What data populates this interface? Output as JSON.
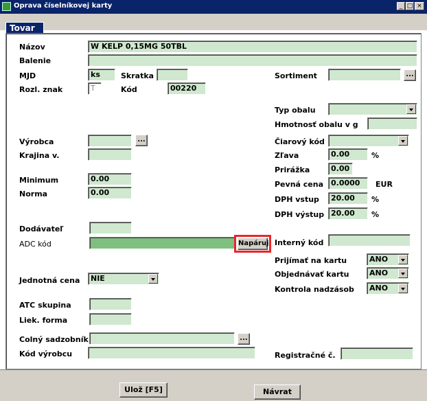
{
  "window": {
    "title": "Oprava číselníkovej karty",
    "controls": {
      "minimize": "_",
      "maximize": "□",
      "close": "×"
    }
  },
  "tabs": [
    {
      "label": "Tovar",
      "active": true
    }
  ],
  "form": {
    "nazov": {
      "label": "Názov",
      "value": "W KELP 0,15MG 50TBL"
    },
    "balenie": {
      "label": "Balenie",
      "value": ""
    },
    "mjd": {
      "label": "MJD",
      "value": "ks"
    },
    "skratka": {
      "label": "Skratka",
      "value": ""
    },
    "sortiment": {
      "label": "Sortiment",
      "value": "",
      "button": "..."
    },
    "rozl_znak": {
      "label": "Rozl. znak",
      "value": "T"
    },
    "kod": {
      "label": "Kód",
      "value": "00220"
    },
    "typ_obalu": {
      "label": "Typ obalu",
      "value": ""
    },
    "hmotnost_obalu": {
      "label": "Hmotnosť obalu v g",
      "value": ""
    },
    "vyrobca": {
      "label": "Výrobca",
      "value": "",
      "button": "..."
    },
    "ciarovy_kod": {
      "label": "Čiarový kód",
      "value": ""
    },
    "krajina": {
      "label": "Krajina v.",
      "value": ""
    },
    "zlava": {
      "label": "Zľava",
      "value": "0.00",
      "unit": "%"
    },
    "prirazka": {
      "label": "Prirážka",
      "value": "0.00"
    },
    "minimum": {
      "label": "Minimum",
      "value": "0.00"
    },
    "pevna_cena": {
      "label": "Pevná cena",
      "value": "0.0000",
      "unit": "EUR"
    },
    "norma": {
      "label": "Norma",
      "value": "0.00"
    },
    "dph_vstup": {
      "label": "DPH vstup",
      "value": "20.00",
      "unit": "%"
    },
    "dph_vystup": {
      "label": "DPH výstup",
      "value": "20.00",
      "unit": "%"
    },
    "dodavatel": {
      "label": "Dodávateľ",
      "value": ""
    },
    "adc_kod": {
      "label": "ADC kód",
      "value": "",
      "button": "Napáruj"
    },
    "interny_kod": {
      "label": "Interný kód",
      "value": ""
    },
    "prijimat": {
      "label": "Prijímať na kartu",
      "value": "ANO"
    },
    "jednotna_cena": {
      "label": "Jednotná cena",
      "value": "NIE"
    },
    "objednavat": {
      "label": "Objednávať kartu",
      "value": "ANO"
    },
    "kontrola": {
      "label": "Kontrola nadzásob",
      "value": "ANO"
    },
    "atc": {
      "label": "ATC skupina",
      "value": ""
    },
    "liek_forma": {
      "label": "Liek. forma",
      "value": ""
    },
    "colny": {
      "label": "Colný sadzobník",
      "value": "",
      "button": "..."
    },
    "kod_vyrobcu": {
      "label": "Kód výrobcu",
      "value": ""
    },
    "registracne": {
      "label": "Registračné č.",
      "value": ""
    }
  },
  "footer": {
    "save": "Ulož [F5]",
    "back": "Návrat"
  },
  "colors": {
    "title_bar": "#0a246a",
    "field_bg": "#cfe8cf",
    "highlight": "#e8262a"
  }
}
